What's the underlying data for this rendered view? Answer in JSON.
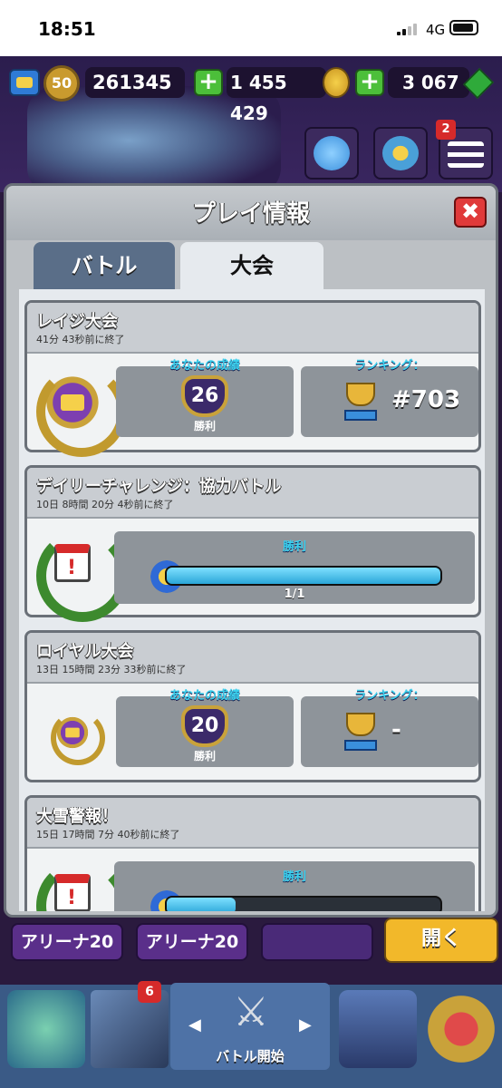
{
  "status_bar": {
    "time": "18:51",
    "network": "4G"
  },
  "top_bar": {
    "level": "50",
    "trophies": "261345",
    "gold": "1 455 429",
    "gems": "3 067",
    "notification_count": "2"
  },
  "modal": {
    "title": "プレイ情報",
    "close_label": "✖",
    "tabs": [
      {
        "label": "バトル"
      },
      {
        "label": "大会"
      }
    ],
    "active_tab": "大会"
  },
  "tournaments": [
    {
      "title": "レイジ大会",
      "ended": "41分 43秒前に終了",
      "result_label": "あなたの成績",
      "wins": "26",
      "wins_label": "勝利",
      "ranking_label": "ランキング：",
      "rank": "#703"
    },
    {
      "title": "デイリーチャレンジ：協力バトル",
      "ended": "10日 8時間 20分 4秒前に終了",
      "progress_label": "勝利",
      "progress_text": "1/1",
      "progress": 1.0
    },
    {
      "title": "ロイヤル大会",
      "ended": "13日 15時間 23分 33秒前に終了",
      "result_label": "あなたの成績",
      "wins": "20",
      "wins_label": "勝利",
      "ranking_label": "ランキング：",
      "rank": "-"
    },
    {
      "title": "大雪警報！",
      "ended": "15日 17時間 7分 40秒前に終了",
      "progress_label": "勝利",
      "progress": 0.25
    }
  ],
  "arena_buttons": [
    {
      "label": "アリーナ20"
    },
    {
      "label": "アリーナ20"
    }
  ],
  "open_button": "開く",
  "bottom_nav": {
    "center_label": "バトル開始",
    "cards_badge": "6"
  }
}
